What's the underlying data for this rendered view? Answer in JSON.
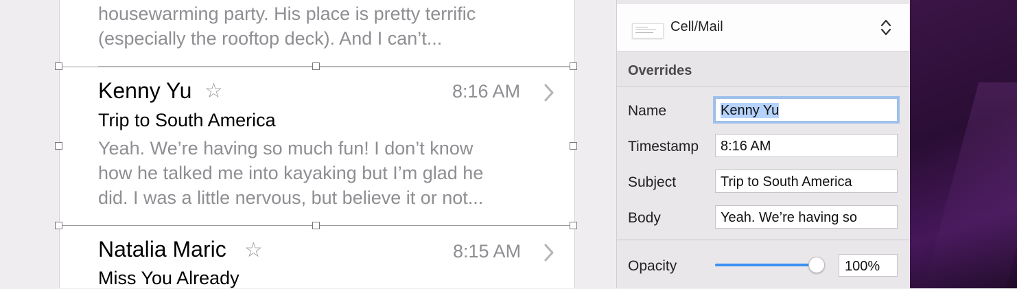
{
  "canvas": {
    "top_preview_lines": [
      "housewarming party. His place is pretty terrific",
      "(especially the rooftop deck). And I can’t..."
    ],
    "cells": [
      {
        "name": "Kenny Yu",
        "time": "8:16 AM",
        "subject": "Trip to South America",
        "body_lines": [
          "Yeah. We’re having so much fun! I don’t know",
          "how he talked me into kayaking but I’m glad he",
          "did. I was a little nervous, but believe it or not..."
        ]
      },
      {
        "name": "Natalia Maric",
        "time": "8:15 AM",
        "subject": "Miss You Already"
      }
    ]
  },
  "inspector": {
    "symbol": {
      "label": "Cell/Mail",
      "icon": "symbol-thumbnail-icon"
    },
    "overrides_title": "Overrides",
    "fields": {
      "name": {
        "label": "Name",
        "value": "Kenny Yu"
      },
      "timestamp": {
        "label": "Timestamp",
        "value": "8:16 AM"
      },
      "subject": {
        "label": "Subject",
        "value": "Trip to South America"
      },
      "body": {
        "label": "Body",
        "value": "Yeah. We’re having so"
      }
    },
    "opacity": {
      "label": "Opacity",
      "value": "100%",
      "level": 1.0
    }
  },
  "colors": {
    "accent": "#3d8ef2",
    "focus_ring": "#9fc1ec",
    "selection_text": "#b5d3fb"
  }
}
